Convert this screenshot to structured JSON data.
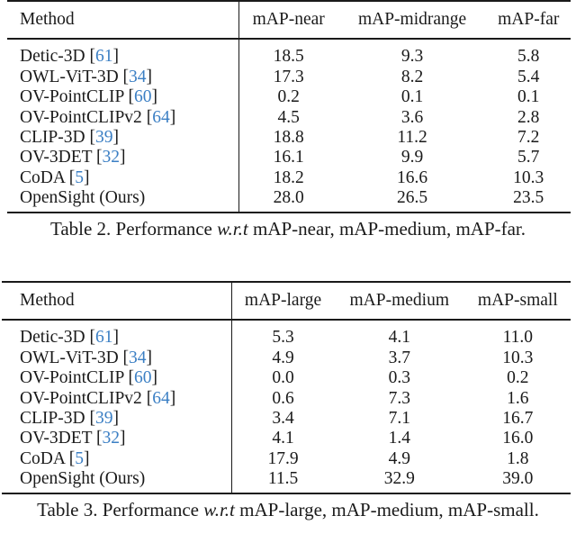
{
  "table2": {
    "columns": [
      "Method",
      "mAP-near",
      "mAP-midrange",
      "mAP-far"
    ],
    "rows": [
      {
        "method": "Detic-3D",
        "cite": "61",
        "values": [
          "18.5",
          "9.3",
          "5.8"
        ]
      },
      {
        "method": "OWL-ViT-3D",
        "cite": "34",
        "values": [
          "17.3",
          "8.2",
          "5.4"
        ]
      },
      {
        "method": "OV-PointCLIP",
        "cite": "60",
        "values": [
          "0.2",
          "0.1",
          "0.1"
        ]
      },
      {
        "method": "OV-PointCLIPv2",
        "cite": "64",
        "values": [
          "4.5",
          "3.6",
          "2.8"
        ]
      },
      {
        "method": "CLIP-3D",
        "cite": "39",
        "values": [
          "18.8",
          "11.2",
          "7.2"
        ]
      },
      {
        "method": "OV-3DET",
        "cite": "32",
        "values": [
          "16.1",
          "9.9",
          "5.7"
        ]
      },
      {
        "method": "CoDA",
        "cite": "5",
        "values": [
          "18.2",
          "16.6",
          "10.3"
        ]
      },
      {
        "method": "OpenSight (Ours)",
        "cite": null,
        "values": [
          "28.0",
          "26.5",
          "23.5"
        ]
      }
    ],
    "caption": {
      "prefix": "Table 2. Performance ",
      "italic": "w.r.t",
      "suffix": " mAP-near, mAP-medium, mAP-far."
    }
  },
  "table3": {
    "columns": [
      "Method",
      "mAP-large",
      "mAP-medium",
      "mAP-small"
    ],
    "rows": [
      {
        "method": "Detic-3D",
        "cite": "61",
        "values": [
          "5.3",
          "4.1",
          "11.0"
        ]
      },
      {
        "method": "OWL-ViT-3D",
        "cite": "34",
        "values": [
          "4.9",
          "3.7",
          "10.3"
        ]
      },
      {
        "method": "OV-PointCLIP",
        "cite": "60",
        "values": [
          "0.0",
          "0.3",
          "0.2"
        ]
      },
      {
        "method": "OV-PointCLIPv2",
        "cite": "64",
        "values": [
          "0.6",
          "7.3",
          "1.6"
        ]
      },
      {
        "method": "CLIP-3D",
        "cite": "39",
        "values": [
          "3.4",
          "7.1",
          "16.7"
        ]
      },
      {
        "method": "OV-3DET",
        "cite": "32",
        "values": [
          "4.1",
          "1.4",
          "16.0"
        ]
      },
      {
        "method": "CoDA",
        "cite": "5",
        "values": [
          "17.9",
          "4.9",
          "1.8"
        ]
      },
      {
        "method": "OpenSight (Ours)",
        "cite": null,
        "values": [
          "11.5",
          "32.9",
          "39.0"
        ]
      }
    ],
    "caption": {
      "prefix": "Table 3. Performance ",
      "italic": "w.r.t",
      "suffix": " mAP-large, mAP-medium, mAP-small."
    }
  },
  "colors": {
    "citation_link": "#3b7fc4",
    "text": "#1a1a1a"
  }
}
